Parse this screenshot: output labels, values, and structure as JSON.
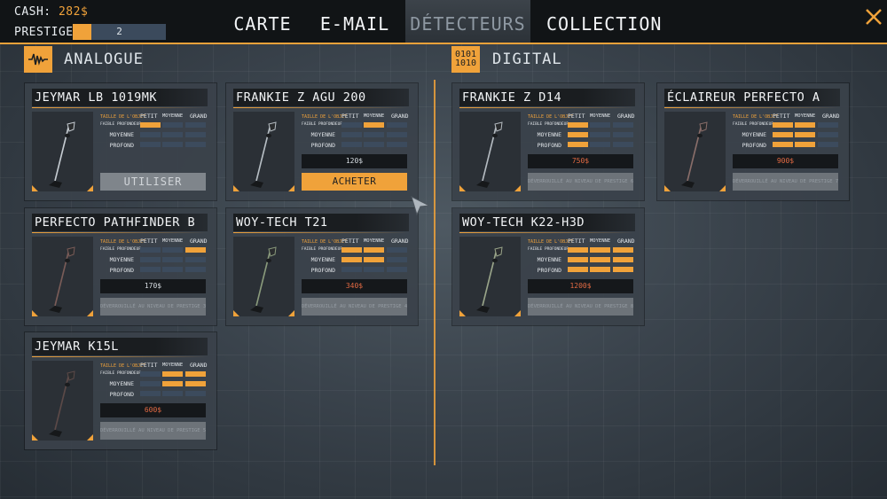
{
  "header": {
    "cash_label": "CASH:",
    "cash_value": "282$",
    "prestige_label": "PRESTIGE :",
    "prestige_level": "2",
    "prestige_progress": 0.2,
    "tabs": [
      {
        "label": "CARTE",
        "active": false
      },
      {
        "label": "E-MAIL",
        "active": false
      },
      {
        "label": "DÉTECTEURS",
        "active": true
      },
      {
        "label": "COLLECTION",
        "active": false
      }
    ],
    "close_icon": "close-x-icon"
  },
  "sections": {
    "analogue": {
      "title": "ANALOGUE",
      "icon": "waveform-icon"
    },
    "digital": {
      "title": "DIGITAL",
      "icon_text_1": "0101",
      "icon_text_2": "1010"
    }
  },
  "stat_headers": {
    "size": "TAILLE DE L'OBJET",
    "small": "PETIT",
    "medium": "MOYENNE",
    "large": "GRAND",
    "depth_low": "FAIBLE PROFONDEUR",
    "depth_mid": "MOYENNE",
    "depth_deep": "PROFOND"
  },
  "colors": {
    "accent": "#f0a23a",
    "price_red": "#e36a43",
    "cell_off": "#3c4b5d"
  },
  "detectors": {
    "c1": {
      "name": "JEYMAR LB 1019MK",
      "grid": [
        [
          1,
          0,
          0
        ],
        [
          0,
          0,
          0
        ],
        [
          0,
          0,
          0
        ]
      ],
      "price": "",
      "button": "UTILISER",
      "button_type": "use"
    },
    "c2": {
      "name": "FRANKIE Z AGU 200",
      "grid": [
        [
          0,
          1,
          0
        ],
        [
          0,
          0,
          0
        ],
        [
          0,
          0,
          0
        ]
      ],
      "price": "120$",
      "price_red": false,
      "button": "ACHETER",
      "button_type": "buy"
    },
    "c3": {
      "name": "PERFECTO PATHFINDER B",
      "grid": [
        [
          0,
          0,
          1
        ],
        [
          0,
          0,
          0
        ],
        [
          0,
          0,
          0
        ]
      ],
      "price": "170$",
      "price_red": false,
      "button": "DÉVERROUILLÉ AU NIVEAU DE PRESTIGE 3",
      "button_type": "locked"
    },
    "c4": {
      "name": "WOY-TECH T21",
      "grid": [
        [
          1,
          1,
          0
        ],
        [
          1,
          1,
          0
        ],
        [
          0,
          0,
          0
        ]
      ],
      "price": "340$",
      "price_red": true,
      "button": "DÉVERROUILLÉ AU NIVEAU DE PRESTIGE 4",
      "button_type": "locked"
    },
    "c5": {
      "name": "JEYMAR K15L",
      "grid": [
        [
          0,
          1,
          1
        ],
        [
          0,
          1,
          1
        ],
        [
          0,
          0,
          0
        ]
      ],
      "price": "600$",
      "price_red": true,
      "button": "DÉVERROUILLÉ AU NIVEAU DE PRESTIGE 5",
      "button_type": "locked"
    },
    "d1": {
      "name": "FRANKIE Z D14",
      "grid": [
        [
          1,
          0,
          0
        ],
        [
          1,
          0,
          0
        ],
        [
          1,
          0,
          0
        ]
      ],
      "price": "750$",
      "price_red": true,
      "button": "DÉVERROUILLÉ AU NIVEAU DE PRESTIGE 6",
      "button_type": "locked"
    },
    "d2": {
      "name": "ÉCLAIREUR PERFECTO A",
      "grid": [
        [
          1,
          1,
          0
        ],
        [
          1,
          1,
          0
        ],
        [
          1,
          1,
          0
        ]
      ],
      "price": "900$",
      "price_red": true,
      "button": "DÉVERROUILLÉ AU NIVEAU DE PRESTIGE 7",
      "button_type": "locked"
    },
    "d3": {
      "name": "WOY-TECH K22-H3D",
      "grid": [
        [
          1,
          1,
          1
        ],
        [
          1,
          1,
          1
        ],
        [
          1,
          1,
          1
        ]
      ],
      "price": "1200$",
      "price_red": true,
      "button": "DÉVERROUILLÉ AU NIVEAU DE PRESTIGE 8",
      "button_type": "locked"
    }
  }
}
